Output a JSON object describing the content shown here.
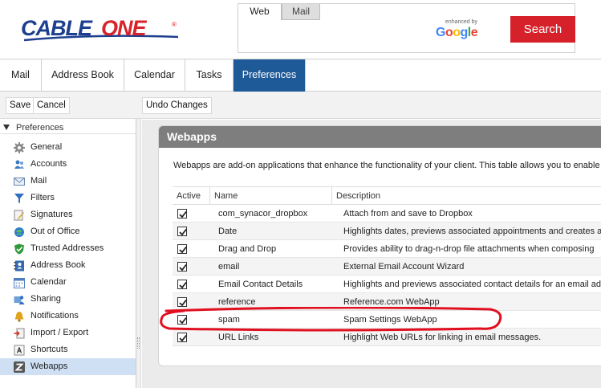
{
  "brand": {
    "name_part1": "CABLE",
    "name_part2": "ONE",
    "trademark": "®"
  },
  "search": {
    "tabs": [
      "Web",
      "Mail"
    ],
    "active_tab": "Web",
    "powered_by_small": "enhanced by",
    "powered_by_brand": "Google",
    "button_label": "Search"
  },
  "nav": {
    "tabs": [
      "Mail",
      "Address Book",
      "Calendar",
      "Tasks",
      "Preferences"
    ],
    "active": "Preferences",
    "active_color": "#1f5a98"
  },
  "toolbar": {
    "save_label": "Save",
    "cancel_label": "Cancel",
    "undo_label": "Undo Changes"
  },
  "sidebar": {
    "header": "Preferences",
    "items": [
      {
        "label": "General",
        "icon": "gear-icon"
      },
      {
        "label": "Accounts",
        "icon": "accounts-icon"
      },
      {
        "label": "Mail",
        "icon": "mail-icon"
      },
      {
        "label": "Filters",
        "icon": "filter-icon"
      },
      {
        "label": "Signatures",
        "icon": "signature-icon"
      },
      {
        "label": "Out of Office",
        "icon": "out-of-office-icon"
      },
      {
        "label": "Trusted Addresses",
        "icon": "shield-icon"
      },
      {
        "label": "Address Book",
        "icon": "address-book-icon"
      },
      {
        "label": "Calendar",
        "icon": "calendar-icon"
      },
      {
        "label": "Sharing",
        "icon": "sharing-icon"
      },
      {
        "label": "Notifications",
        "icon": "bell-icon"
      },
      {
        "label": "Import / Export",
        "icon": "import-export-icon"
      },
      {
        "label": "Shortcuts",
        "icon": "shortcuts-icon"
      },
      {
        "label": "Webapps",
        "icon": "webapps-icon"
      }
    ],
    "selected": "Webapps"
  },
  "panel": {
    "title": "Webapps",
    "description": "Webapps are add-on applications that enhance the functionality of your client. This table allows you to enable",
    "columns": [
      "Active",
      "Name",
      "Description"
    ],
    "rows": [
      {
        "active": true,
        "name": "com_synacor_dropbox",
        "description": "Attach from and save to Dropbox"
      },
      {
        "active": true,
        "name": "Date",
        "description": "Highlights dates, previews associated appointments and creates a"
      },
      {
        "active": true,
        "name": "Drag and Drop",
        "description": "Provides ability to drag-n-drop file attachments when composing"
      },
      {
        "active": true,
        "name": "email",
        "description": "External Email Account Wizard"
      },
      {
        "active": true,
        "name": "Email Contact Details",
        "description": "Highlights and previews associated contact details for an email ad"
      },
      {
        "active": true,
        "name": "reference",
        "description": "Reference.com WebApp"
      },
      {
        "active": true,
        "name": "spam",
        "description": "Spam Settings WebApp"
      },
      {
        "active": true,
        "name": "URL Links",
        "description": "Highlight Web URLs for linking in email messages."
      }
    ]
  },
  "colors": {
    "brand_blue": "#1d3f8f",
    "brand_red": "#d8232a",
    "search_red": "#d6212a",
    "annotation_red": "#e01020"
  }
}
